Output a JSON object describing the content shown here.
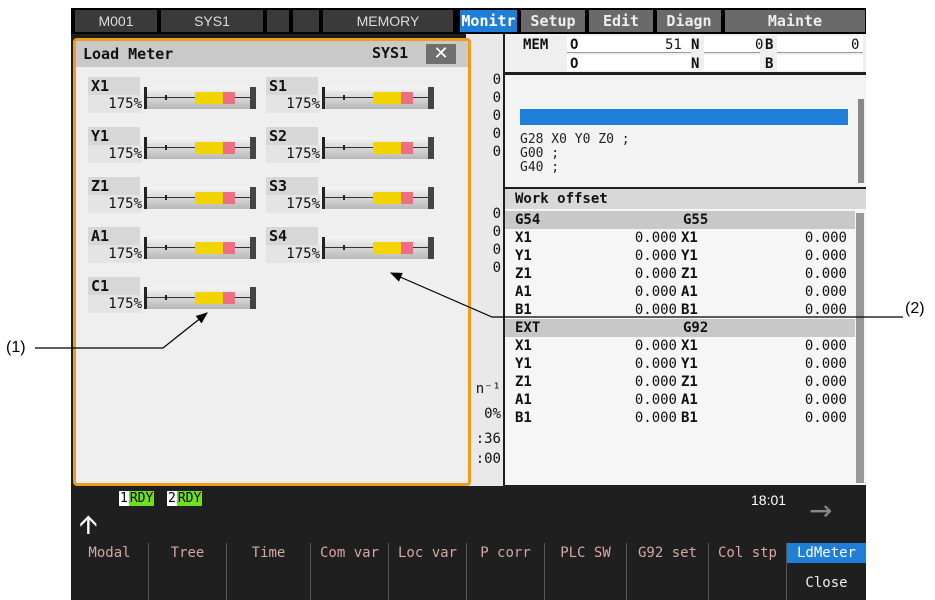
{
  "status_bar": {
    "machine": "M001",
    "system": "SYS1",
    "mode": "MEMORY"
  },
  "tabs": [
    {
      "label": "Monitr",
      "active": true
    },
    {
      "label": "Setup",
      "active": false
    },
    {
      "label": "Edit",
      "active": false
    },
    {
      "label": "Diagn",
      "active": false
    },
    {
      "label": "Mainte",
      "active": false
    }
  ],
  "mem_panel": {
    "mode": "MEM",
    "o_label": "O",
    "o_value": "51",
    "n_label": "N",
    "n_value": "0",
    "b_label": "B",
    "b_value": "0",
    "o2_label": "O",
    "n2_label": "N",
    "b2_label": "B"
  },
  "program": {
    "lines": [
      "G28 X0 Y0 Z0 ;",
      "G00 ;",
      "G40 ;"
    ]
  },
  "work_offset": {
    "title": "Work offset",
    "groups": [
      {
        "left": "G54",
        "right": "G55",
        "rows": [
          [
            "X1",
            "0.000",
            "X1",
            "0.000"
          ],
          [
            "Y1",
            "0.000",
            "Y1",
            "0.000"
          ],
          [
            "Z1",
            "0.000",
            "Z1",
            "0.000"
          ],
          [
            "A1",
            "0.000",
            "A1",
            "0.000"
          ],
          [
            "B1",
            "0.000",
            "B1",
            "0.000"
          ]
        ]
      },
      {
        "left": "EXT",
        "right": "G92",
        "rows": [
          [
            "X1",
            "0.000",
            "X1",
            "0.000"
          ],
          [
            "Y1",
            "0.000",
            "Y1",
            "0.000"
          ],
          [
            "Z1",
            "0.000",
            "Z1",
            "0.000"
          ],
          [
            "A1",
            "0.000",
            "A1",
            "0.000"
          ],
          [
            "B1",
            "0.000",
            "B1",
            "0.000"
          ]
        ]
      }
    ]
  },
  "mid_strip": [
    "0",
    "0",
    "0",
    "0",
    "0",
    "0",
    "0",
    "0",
    "0",
    "n⁻¹",
    "0%",
    ":36",
    ":00"
  ],
  "load_meter": {
    "title": "Load Meter",
    "system": "SYS1",
    "close_icon": "close-icon",
    "axes": [
      {
        "name": "X1",
        "percent": "175%",
        "load": 1.75
      },
      {
        "name": "S1",
        "percent": "175%",
        "load": 1.75
      },
      {
        "name": "Y1",
        "percent": "175%",
        "load": 1.75
      },
      {
        "name": "S2",
        "percent": "175%",
        "load": 1.75
      },
      {
        "name": "Z1",
        "percent": "175%",
        "load": 1.75
      },
      {
        "name": "S3",
        "percent": "175%",
        "load": 1.75
      },
      {
        "name": "A1",
        "percent": "175%",
        "load": 1.75
      },
      {
        "name": "S4",
        "percent": "175%",
        "load": 1.75
      },
      {
        "name": "C1",
        "percent": "175%",
        "load": 1.75
      }
    ]
  },
  "ready": [
    {
      "num": "1",
      "label": "RDY"
    },
    {
      "num": "2",
      "label": "RDY"
    }
  ],
  "clock": "18:01",
  "function_keys": [
    {
      "label": "Modal"
    },
    {
      "label": "Tree"
    },
    {
      "label": "Time"
    },
    {
      "label": "Com var"
    },
    {
      "label": "Loc var"
    },
    {
      "label": "P corr"
    },
    {
      "label": "PLC SW"
    },
    {
      "label": "G92 set"
    },
    {
      "label": "Col stp"
    },
    {
      "label": "LdMeter",
      "sub": "Close",
      "active": true
    }
  ],
  "callouts": {
    "one": "(1)",
    "two": "(2)"
  },
  "colors": {
    "accent": "#1f7fd8",
    "frame": "#f29a1b",
    "meter_yellow": "#f2d400",
    "meter_red": "#ee6e83",
    "ready_green": "#6ce01b"
  }
}
